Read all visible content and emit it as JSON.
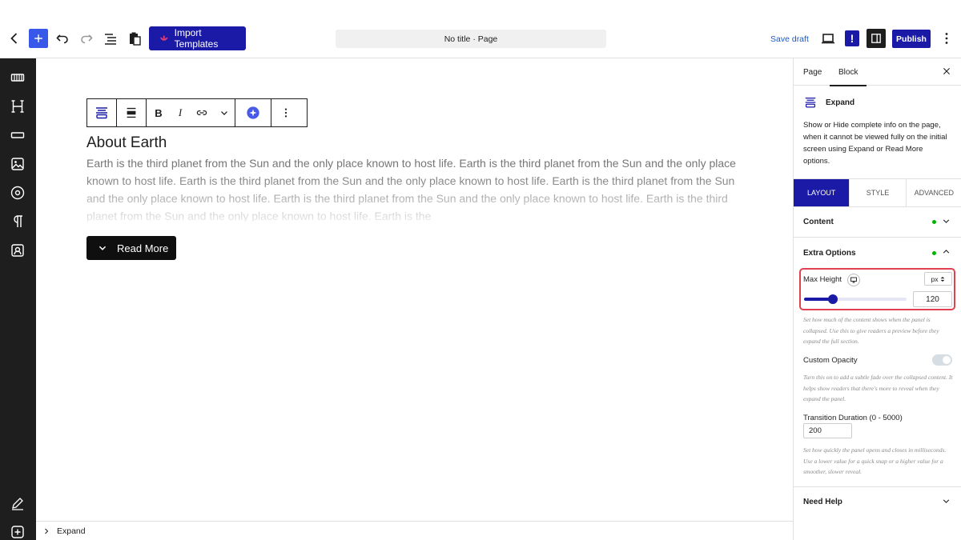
{
  "header": {
    "import_label": "Import Templates",
    "doc_title": "No title · Page",
    "save_draft": "Save draft",
    "publish": "Publish",
    "notice": "!"
  },
  "editor": {
    "heading": "About Earth",
    "body": "Earth is the third planet from the Sun and the only place known to host life. Earth is the third planet from the Sun and the only place known to host life. Earth is the third planet from the Sun and the only place known to host life. Earth is the third planet from the Sun and the only place known to host life. Earth is the third planet from the Sun and the only place known to host life. Earth is the third planet from the Sun and the only place known to host life. Earth is the",
    "read_more": "Read More",
    "toolbar": {
      "bold": "B",
      "italic": "I"
    }
  },
  "breadcrumb": {
    "item": "Expand"
  },
  "panel": {
    "tabs": [
      "Page",
      "Block"
    ],
    "active_tab": "Block",
    "block_name": "Expand",
    "block_description": "Show or Hide complete info on the page, when it cannot be viewed fully on the initial screen using Expand or Read More options.",
    "segments": [
      "LAYOUT",
      "STYLE",
      "ADVANCED"
    ],
    "active_segment": "LAYOUT",
    "content_label": "Content",
    "extra_options_label": "Extra Options",
    "max_height": {
      "label": "Max Height",
      "unit": "px",
      "value": "120",
      "slider_fraction": 0.28,
      "help": "Set how much of the content shows when the panel is collapsed. Use this to give readers a preview before they expand the full section."
    },
    "custom_opacity": {
      "label": "Custom Opacity",
      "enabled": false,
      "help": "Turn this on to add a subtle fade over the collapsed content. It helps show readers that there's more to reveal when they expand the panel."
    },
    "transition": {
      "label": "Transition Duration (0 - 5000)",
      "value": "200",
      "help": "Set how quickly the panel opens and closes in milliseconds. Use a lower value for a quick snap or a higher value for a smoother, slower reveal."
    },
    "need_help": "Need Help"
  },
  "colors": {
    "accent": "#1a1aa6",
    "wp_blue": "#3858e9",
    "highlight": "#e04050",
    "status_dot": "#00b300"
  }
}
